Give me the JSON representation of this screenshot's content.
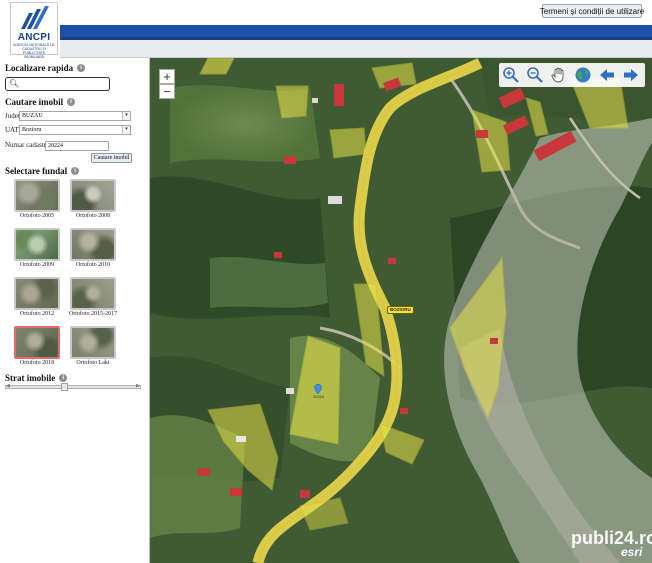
{
  "header": {
    "logo_text": "ANCPI",
    "logo_subtitle": "AGENȚIA NAȚIONALĂ DE CADASTRU ȘI PUBLICITATE IMOBILIARĂ",
    "terms_label": "Termeni și condiții de utilizare",
    "colors": {
      "band": "#1e4fa6",
      "band_dark": "#1a3f86",
      "grey_band": "#e9ebee"
    }
  },
  "sidebar": {
    "quick_search": {
      "title": "Localizare rapida",
      "value": "",
      "placeholder": ""
    },
    "property_search": {
      "title": "Cautare imobil",
      "judet_label": "Judet:",
      "judet_value": "BUZAU",
      "uat_label": "UAT:",
      "uat_value": "Bozioru",
      "cadastral_label": "Numar cadastral:",
      "cadastral_value": "20224",
      "search_button": "Cautare imobil"
    },
    "background_select": {
      "title": "Selectare fundal",
      "options": [
        {
          "label": "Ortofoto 2005",
          "selected": false
        },
        {
          "label": "Ortofoto 2008",
          "selected": false
        },
        {
          "label": "Ortofoto 2009",
          "selected": false
        },
        {
          "label": "Ortofoto 2010",
          "selected": false
        },
        {
          "label": "Ortofoto 2012",
          "selected": false
        },
        {
          "label": "Ortofoto 2015-2017",
          "selected": false
        },
        {
          "label": "Ortofoto 2018",
          "selected": true
        },
        {
          "label": "Ortofoto Laki",
          "selected": false
        }
      ]
    },
    "property_layer": {
      "title": "Strat imobile",
      "opacity": 0.42
    }
  },
  "map": {
    "zoom_in": "+",
    "zoom_out": "−",
    "tools": [
      {
        "icon": "zoom-in-icon"
      },
      {
        "icon": "zoom-out-icon"
      },
      {
        "icon": "pan-hand-icon"
      },
      {
        "icon": "globe-icon"
      },
      {
        "icon": "arrow-left-icon"
      },
      {
        "icon": "arrow-right-icon"
      }
    ],
    "road_label": "BOZIORU",
    "parcel_label": "20224",
    "attribution": "esri",
    "watermark": "publi24.ro",
    "colors": {
      "parcel_fill": "#e7e24a",
      "road": "#ead54a",
      "roof": "#c8373a"
    }
  }
}
